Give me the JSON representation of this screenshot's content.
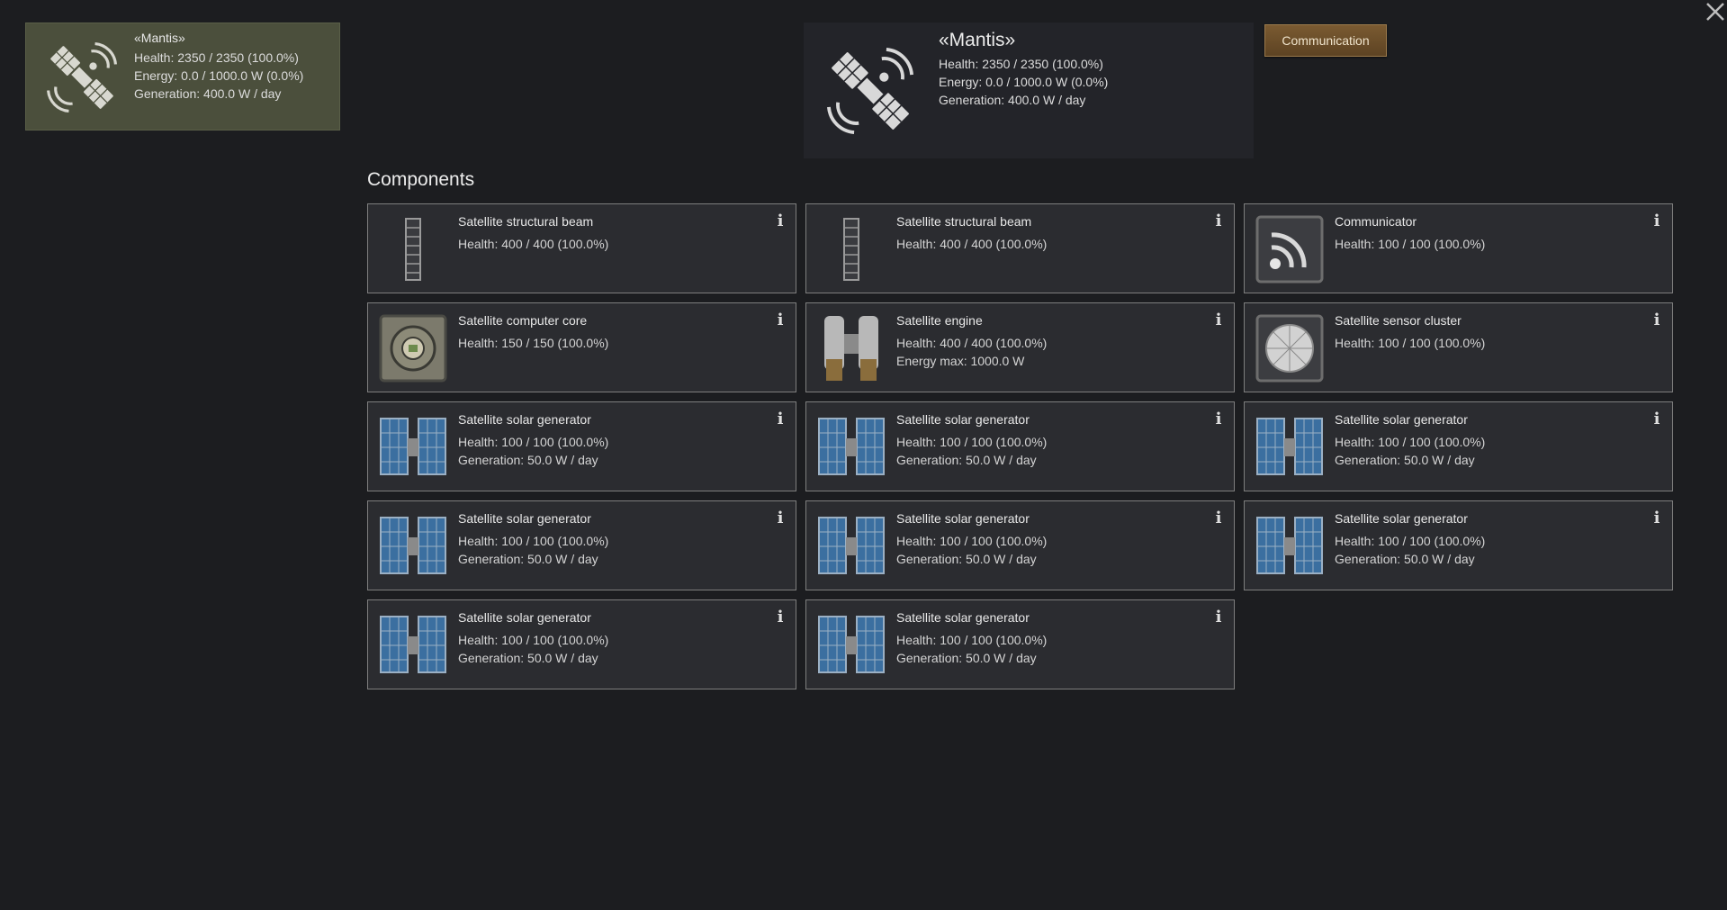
{
  "satellite_tab": {
    "name": "«Mantis»",
    "health": "Health: 2350 / 2350 (100.0%)",
    "energy": "Energy: 0.0 / 1000.0 W (0.0%)",
    "generation": "Generation: 400.0 W / day",
    "icon": "satellite-icon"
  },
  "summary": {
    "name": "«Mantis»",
    "health": "Health: 2350 / 2350 (100.0%)",
    "energy": "Energy: 0.0 / 1000.0 W (0.0%)",
    "generation": "Generation: 400.0 W / day",
    "icon": "satellite-icon"
  },
  "communication_button": {
    "label": "Communication"
  },
  "close_button": {
    "icon": "close-icon"
  },
  "components": {
    "title": "Components",
    "items": [
      {
        "title": "Satellite structural beam",
        "line1": "Health: 400 / 400 (100.0%)",
        "line2": "",
        "icon": "beam-icon"
      },
      {
        "title": "Satellite structural beam",
        "line1": "Health: 400 / 400 (100.0%)",
        "line2": "",
        "icon": "beam-icon"
      },
      {
        "title": "Communicator",
        "line1": "Health: 100 / 100 (100.0%)",
        "line2": "",
        "icon": "communicator-icon"
      },
      {
        "title": "Satellite computer core",
        "line1": "Health: 150 / 150 (100.0%)",
        "line2": "",
        "icon": "computer-core-icon"
      },
      {
        "title": "Satellite engine",
        "line1": "Health: 400 / 400 (100.0%)",
        "line2": "Energy max: 1000.0 W",
        "icon": "engine-icon"
      },
      {
        "title": "Satellite sensor cluster",
        "line1": "Health: 100 / 100 (100.0%)",
        "line2": "",
        "icon": "sensor-cluster-icon"
      },
      {
        "title": "Satellite solar generator",
        "line1": "Health: 100 / 100 (100.0%)",
        "line2": "Generation: 50.0 W / day",
        "icon": "solar-panel-icon"
      },
      {
        "title": "Satellite solar generator",
        "line1": "Health: 100 / 100 (100.0%)",
        "line2": "Generation: 50.0 W / day",
        "icon": "solar-panel-icon"
      },
      {
        "title": "Satellite solar generator",
        "line1": "Health: 100 / 100 (100.0%)",
        "line2": "Generation: 50.0 W / day",
        "icon": "solar-panel-icon"
      },
      {
        "title": "Satellite solar generator",
        "line1": "Health: 100 / 100 (100.0%)",
        "line2": "Generation: 50.0 W / day",
        "icon": "solar-panel-icon"
      },
      {
        "title": "Satellite solar generator",
        "line1": "Health: 100 / 100 (100.0%)",
        "line2": "Generation: 50.0 W / day",
        "icon": "solar-panel-icon"
      },
      {
        "title": "Satellite solar generator",
        "line1": "Health: 100 / 100 (100.0%)",
        "line2": "Generation: 50.0 W / day",
        "icon": "solar-panel-icon"
      },
      {
        "title": "Satellite solar generator",
        "line1": "Health: 100 / 100 (100.0%)",
        "line2": "Generation: 50.0 W / day",
        "icon": "solar-panel-icon"
      },
      {
        "title": "Satellite solar generator",
        "line1": "Health: 100 / 100 (100.0%)",
        "line2": "Generation: 50.0 W / day",
        "icon": "solar-panel-icon"
      }
    ]
  },
  "colors": {
    "background": "#1c1d20",
    "card": "#2b2c30",
    "selected_tab": "#4b4f3c",
    "button": "#7a5a31"
  }
}
